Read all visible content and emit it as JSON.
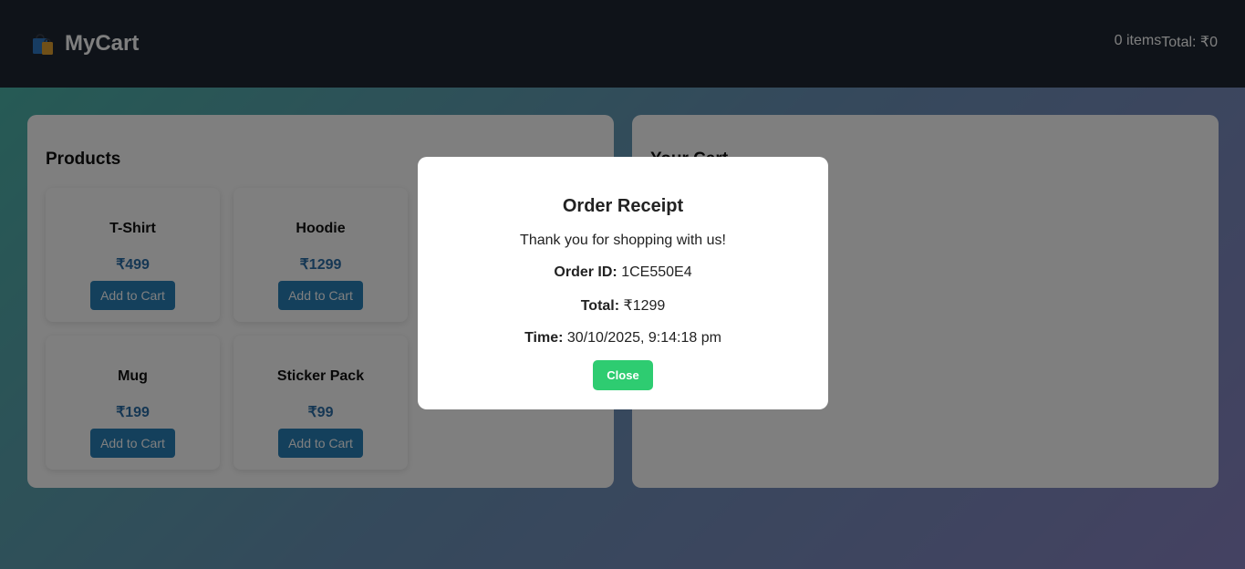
{
  "header": {
    "brand": "MyCart",
    "items_count": "0 items",
    "total": "Total: ₹0"
  },
  "products": {
    "title": "Products",
    "items": [
      {
        "name": "T-Shirt",
        "price": "₹499",
        "button": "Add to Cart"
      },
      {
        "name": "Hoodie",
        "price": "₹1299",
        "button": "Add to Cart"
      },
      {
        "name": "Mug",
        "price": "₹199",
        "button": "Add to Cart"
      },
      {
        "name": "Sticker Pack",
        "price": "₹99",
        "button": "Add to Cart"
      }
    ]
  },
  "cart": {
    "title": "Your Cart"
  },
  "receipt": {
    "title": "Order Receipt",
    "thanks": "Thank you for shopping with us!",
    "order_id_label": "Order ID:",
    "order_id": "1CE550E4",
    "total_label": "Total:",
    "total": "₹1299",
    "time_label": "Time:",
    "time": "30/10/2025, 9:14:18 pm",
    "close": "Close"
  },
  "colors": {
    "header_bg": "#1e2733",
    "price": "#2b6ea8",
    "add_button": "#2980b9",
    "close_button": "#2ecc71"
  },
  "icons": {
    "brand": "shopping-bags-icon"
  }
}
